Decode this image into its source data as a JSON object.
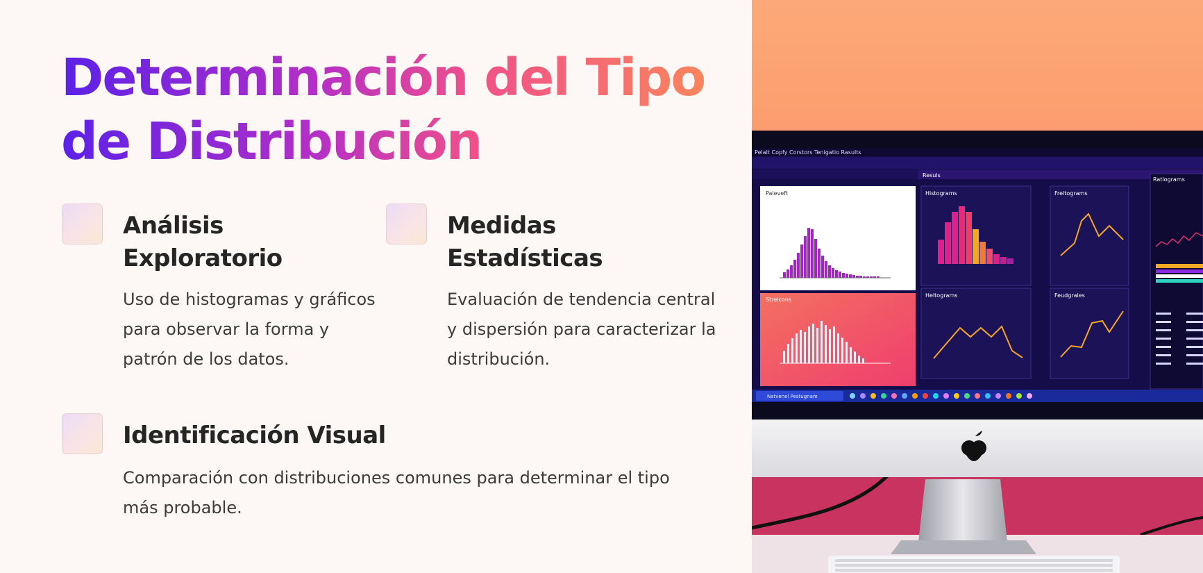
{
  "title": "Determinación del Tipo de Distribución",
  "cards": [
    {
      "title": "Análisis Exploratorio",
      "description": "Uso de histogramas y gráficos para observar la forma y patrón de los datos."
    },
    {
      "title": "Medidas Estadísticas",
      "description": "Evaluación de tendencia central y dispersión para caracterizar la distribución."
    },
    {
      "title": "Identificación Visual",
      "description": "Comparación con distribuciones comunes para determinar el tipo más probable."
    }
  ],
  "photo": {
    "menu": "Pelalt Copfy Corstors Tenigatio Rasults",
    "results_label": "Resuls",
    "panels": [
      "Paleveft",
      "Histograms",
      "Freltograms",
      "Ratlograms",
      "Strelcons",
      "Heltograms",
      "Feudgrales"
    ],
    "taskbar_search": "Natvenel Pestugnam",
    "colors": {
      "screen_bg": "#150c4a",
      "accent_pink": "#e0208a",
      "accent_orange": "#f5a623"
    }
  }
}
